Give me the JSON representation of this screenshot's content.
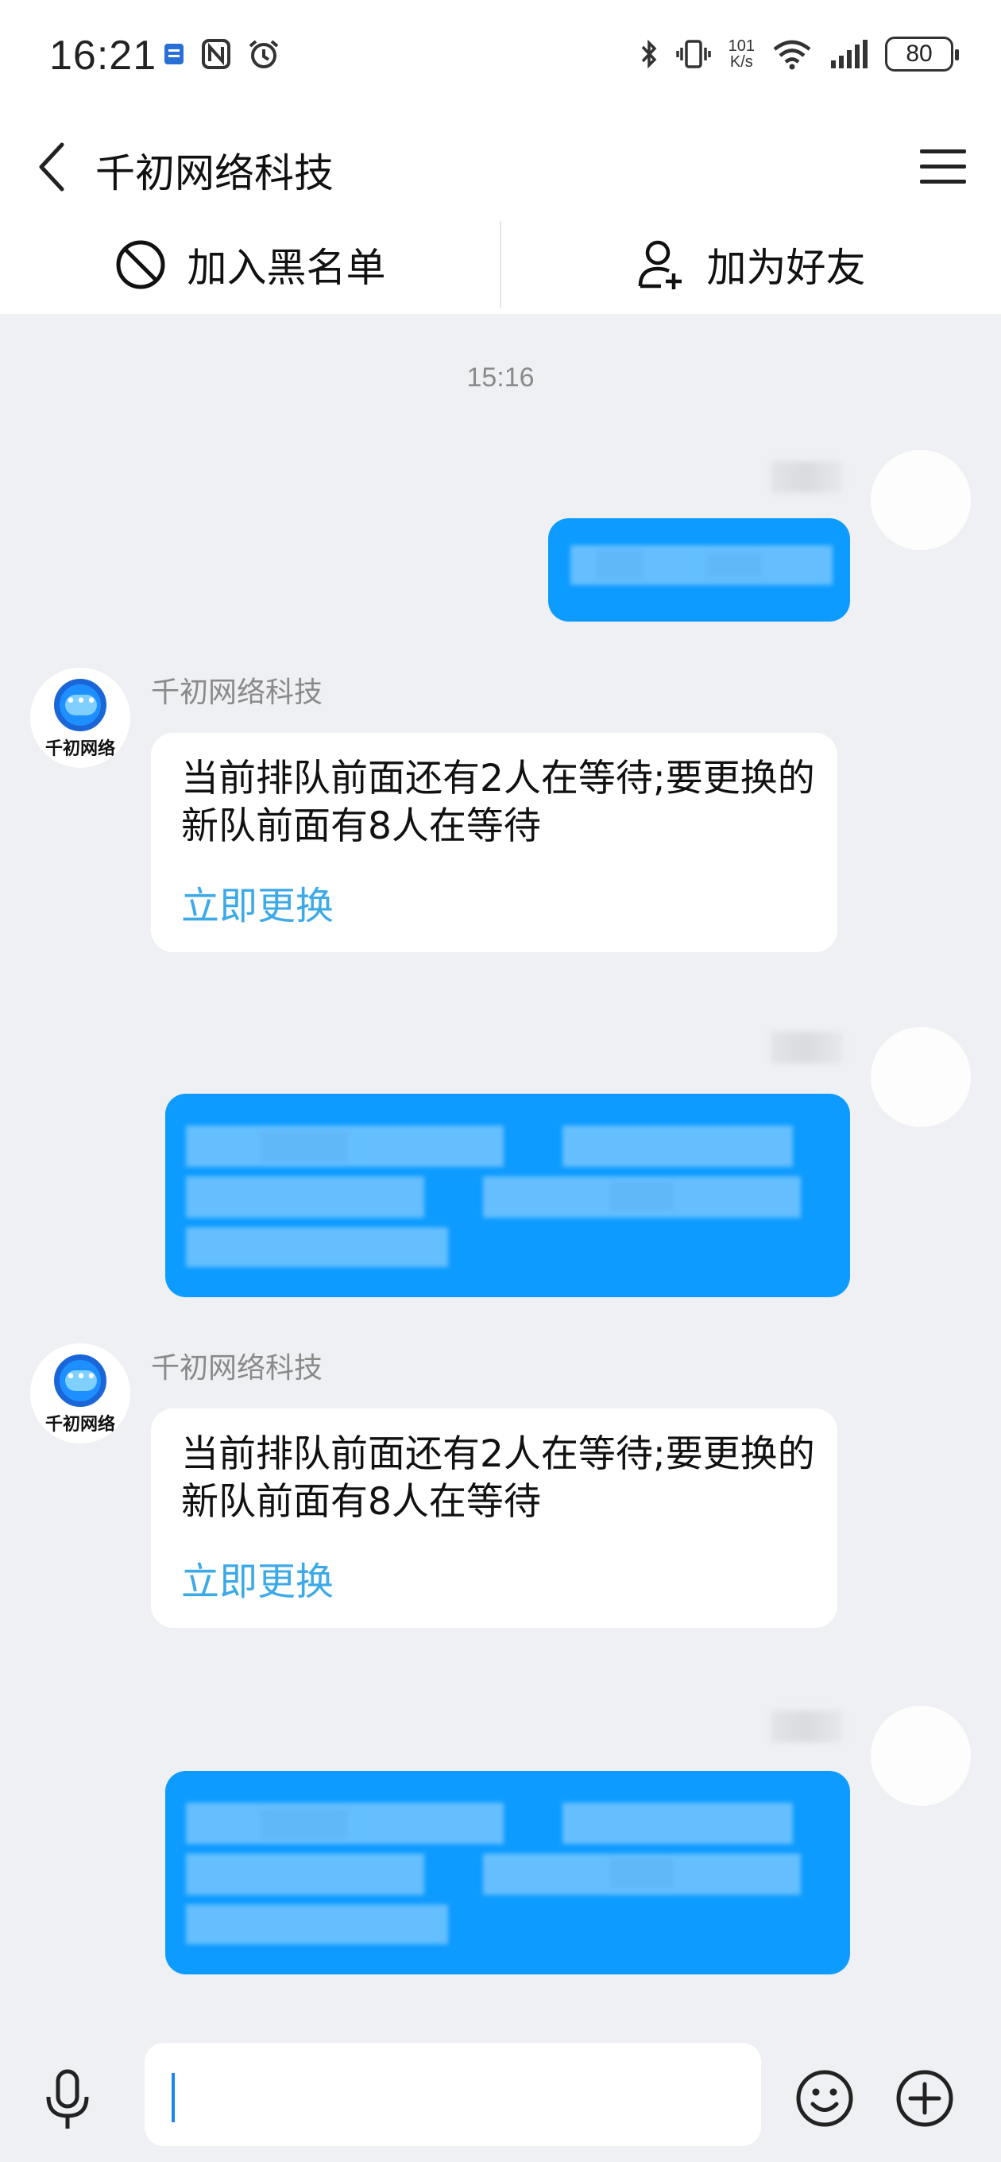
{
  "status_bar": {
    "time": "16:21",
    "network_speed_value": "101",
    "network_speed_unit": "K/s",
    "battery": "80"
  },
  "header": {
    "title": "千初网络科技"
  },
  "actions": {
    "blacklist_label": "加入黑名单",
    "add_friend_label": "加为好友"
  },
  "chat": {
    "timestamp": "15:16",
    "bot_name": "千初网络科技",
    "bot_logo_text": "千初网络",
    "messages": [
      {
        "from": "bot",
        "text": "当前排队前面还有2人在等待;要更换的新队前面有8人在等待",
        "link": "立即更换"
      },
      {
        "from": "bot",
        "text": "当前排队前面还有2人在等待;要更换的新队前面有8人在等待",
        "link": "立即更换"
      }
    ]
  },
  "input": {
    "value": "",
    "placeholder": ""
  },
  "colors": {
    "self_bubble": "#0d9bff",
    "link": "#3ca9e8",
    "background": "#eff0f4"
  }
}
